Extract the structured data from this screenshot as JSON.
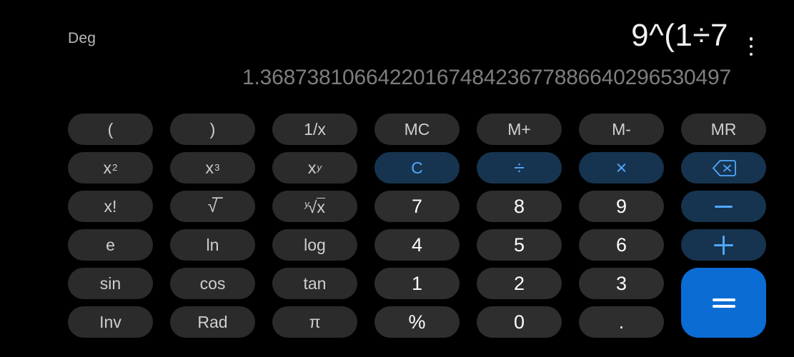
{
  "app": {
    "name": "Calculator",
    "background": "#000000"
  },
  "display": {
    "angle_mode": "Deg",
    "expression": "9^(1÷7",
    "result": "1.3687381066422016748423677886640296530497",
    "overflow_menu_icon": "more-vertical-icon"
  },
  "colors": {
    "background": "#000000",
    "key_default": "#2b2b2b",
    "key_digit": "#2e2e2e",
    "key_operator": "#16344f",
    "operator_text": "#51a8ff",
    "equals_background": "#0b6cd4",
    "equals_text": "#ffffff",
    "text_default": "#cfcfcf",
    "text_digit": "#fdfdfd",
    "text_result": "#7d7d7d",
    "text_expression": "#f2f2f2"
  },
  "keypad": {
    "rows": [
      [
        {
          "label": "(",
          "name": "key-open-paren",
          "style": "function"
        },
        {
          "label": ")",
          "name": "key-close-paren",
          "style": "function"
        },
        {
          "label": "1/x",
          "name": "key-reciprocal",
          "style": "function"
        },
        {
          "label": "MC",
          "name": "key-memory-clear",
          "style": "function"
        },
        {
          "label": "M+",
          "name": "key-memory-add",
          "style": "function"
        },
        {
          "label": "M-",
          "name": "key-memory-subtract",
          "style": "function"
        },
        {
          "label": "MR",
          "name": "key-memory-recall",
          "style": "function"
        }
      ],
      [
        {
          "label": "x2",
          "name": "key-square",
          "style": "function"
        },
        {
          "label": "x3",
          "name": "key-cube",
          "style": "function"
        },
        {
          "label": "xy",
          "name": "key-power",
          "style": "function"
        },
        {
          "label": "C",
          "name": "key-clear",
          "style": "operator"
        },
        {
          "label": "÷",
          "name": "key-divide",
          "style": "operator"
        },
        {
          "label": "×",
          "name": "key-multiply",
          "style": "operator"
        },
        {
          "label": "backspace",
          "name": "key-backspace",
          "style": "operator"
        }
      ],
      [
        {
          "label": "x!",
          "name": "key-factorial",
          "style": "function"
        },
        {
          "label": "√",
          "name": "key-square-root",
          "style": "function"
        },
        {
          "label": "y√x",
          "name": "key-nth-root",
          "style": "function"
        },
        {
          "label": "7",
          "name": "key-7",
          "style": "digit"
        },
        {
          "label": "8",
          "name": "key-8",
          "style": "digit"
        },
        {
          "label": "9",
          "name": "key-9",
          "style": "digit"
        },
        {
          "label": "−",
          "name": "key-subtract",
          "style": "operator"
        }
      ],
      [
        {
          "label": "e",
          "name": "key-euler",
          "style": "function"
        },
        {
          "label": "ln",
          "name": "key-natural-log",
          "style": "function"
        },
        {
          "label": "log",
          "name": "key-log",
          "style": "function"
        },
        {
          "label": "4",
          "name": "key-4",
          "style": "digit"
        },
        {
          "label": "5",
          "name": "key-5",
          "style": "digit"
        },
        {
          "label": "6",
          "name": "key-6",
          "style": "digit"
        },
        {
          "label": "+",
          "name": "key-add",
          "style": "operator"
        }
      ],
      [
        {
          "label": "sin",
          "name": "key-sin",
          "style": "function"
        },
        {
          "label": "cos",
          "name": "key-cos",
          "style": "function"
        },
        {
          "label": "tan",
          "name": "key-tan",
          "style": "function"
        },
        {
          "label": "1",
          "name": "key-1",
          "style": "digit"
        },
        {
          "label": "2",
          "name": "key-2",
          "style": "digit"
        },
        {
          "label": "3",
          "name": "key-3",
          "style": "digit"
        },
        {
          "label": "=",
          "name": "key-equals",
          "style": "equals"
        }
      ],
      [
        {
          "label": "Inv",
          "name": "key-inverse",
          "style": "function"
        },
        {
          "label": "Rad",
          "name": "key-radian-toggle",
          "style": "function"
        },
        {
          "label": "π",
          "name": "key-pi",
          "style": "function"
        },
        {
          "label": "%",
          "name": "key-percent",
          "style": "digit"
        },
        {
          "label": "0",
          "name": "key-0",
          "style": "digit"
        },
        {
          "label": ".",
          "name": "key-decimal",
          "style": "digit"
        }
      ]
    ]
  }
}
